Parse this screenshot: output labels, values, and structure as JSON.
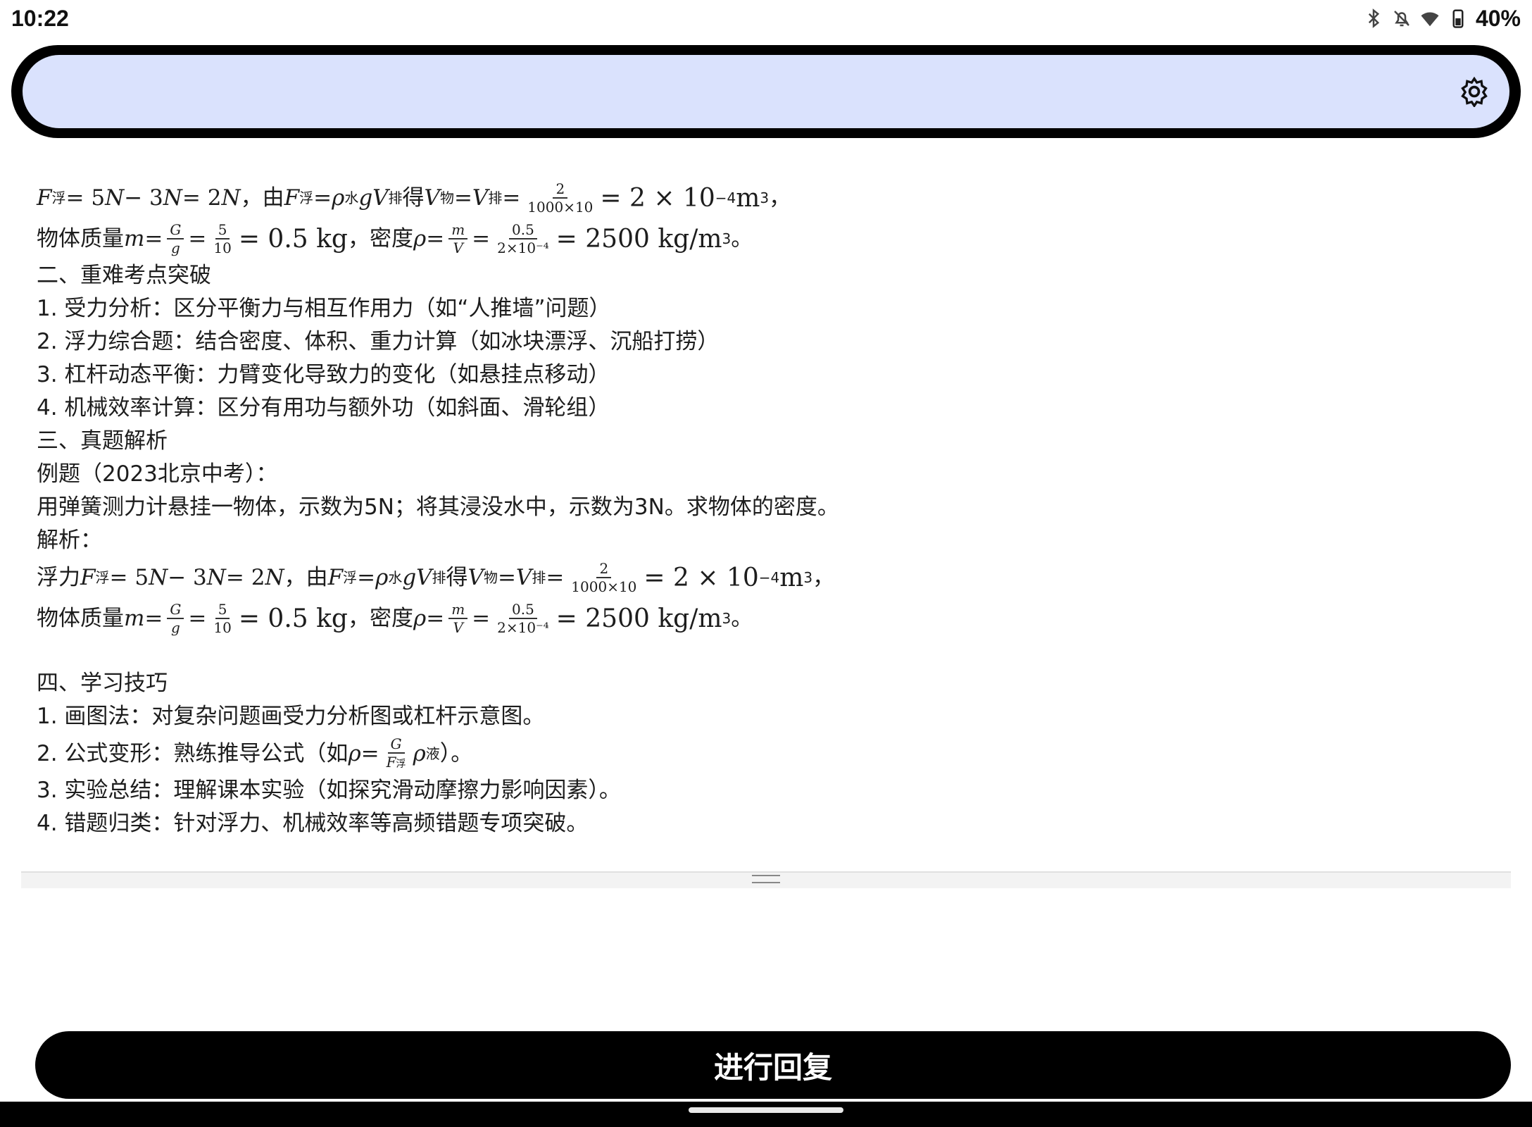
{
  "status_bar": {
    "time": "10:22",
    "battery": "40%",
    "icons": [
      "bluetooth-icon",
      "notifications-off-icon",
      "wifi-icon",
      "battery-icon"
    ]
  },
  "search": {
    "placeholder": "",
    "settings_icon": "settings-icon"
  },
  "content": {
    "l1": {
      "f_float": "F",
      "sub_float": "浮",
      "eq1": " = 5",
      "n1": "N",
      "minus": " − 3",
      "n2": "N",
      "eq2": " = 2",
      "n3": "N",
      "text_you": "，由 ",
      "f2": "F",
      "sub2": "浮",
      "eq3": " = ",
      "rho": "ρ",
      "sub_water": "水",
      "gv": "gV",
      "sub_pai": "排",
      "text_de": " 得 ",
      "v_wu": "V",
      "sub_wu": "物",
      "eq4": " = ",
      "v_pai": "V",
      "sub_pai2": "排",
      "eq5": " = ",
      "frac_num": "2",
      "frac_den": "1000×10",
      "result": " = 2 × 10",
      "exp": "−4",
      "unit": " m",
      "unit_exp": "3",
      "tail": "，"
    },
    "l2": {
      "label_mass": "物体质量 ",
      "m": "m",
      "eq1": " = ",
      "frac1_num": "G",
      "frac1_den": "g",
      "eq2": " = ",
      "frac2_num": "5",
      "frac2_den": "10",
      "result1": " = 0.5 kg",
      "label_density": "，密度 ",
      "rho": "ρ",
      "eq3": " = ",
      "frac3_num": "m",
      "frac3_den": "V",
      "eq4": " = ",
      "frac4_num": "0.5",
      "frac4_den": "2×10⁻⁴",
      "result2": " = 2500 kg/m",
      "unit_exp": "3",
      "tail": "。"
    },
    "h2": "二、重难考点突破",
    "k1": "1. 受力分析：区分平衡力与相互作用力（如“人推墙”问题）",
    "k2": "2. 浮力综合题：结合密度、体积、重力计算（如冰块漂浮、沉船打捞）",
    "k3": "3. 杠杆动态平衡：力臂变化导致力的变化（如悬挂点移动）",
    "k4": "4. 机械效率计算：区分有用功与额外功（如斜面、滑轮组）",
    "h3": "三、真题解析",
    "example_title": "例题（2023北京中考）：",
    "example_text": "用弹簧测力计悬挂一物体，示数为5N；将其浸没水中，示数为3N。求物体的密度。",
    "analysis_label": "解析：",
    "l3_prefix": "浮力 ",
    "h4": "四、学习技巧",
    "t1": "1. 画图法：对复杂问题画受力分析图或杠杆示意图。",
    "t2_prefix": "2. 公式变形：熟练推导公式（如 ",
    "t2_rho": "ρ",
    "t2_eq": " = ",
    "t2_frac_num": "G",
    "t2_frac_den_f": "F",
    "t2_frac_den_sub": "浮",
    "t2_rho2": "ρ",
    "t2_sub_liquid": "液",
    "t2_suffix": "）。",
    "t3": "3. 实验总结：理解课本实验（如探究滑动摩擦力影响因素）。",
    "t4": "4. 错题归类：针对浮力、机械效率等高频错题专项突破。"
  },
  "reply_button": {
    "label": "进行回复"
  }
}
